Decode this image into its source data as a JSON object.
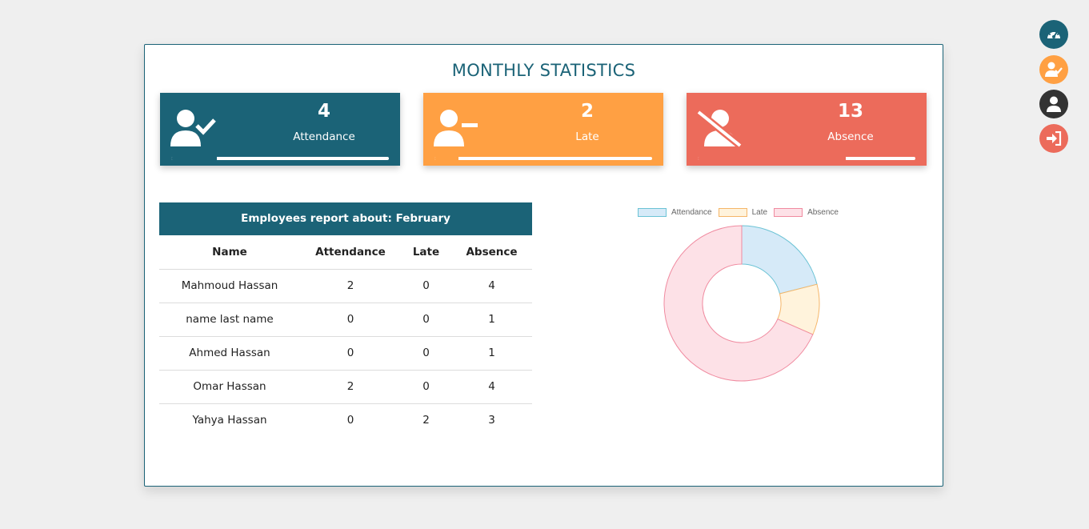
{
  "page": {
    "title": "MONTHLY STATISTICS"
  },
  "stats": [
    {
      "value": "4",
      "label": "Attendance",
      "icon": "user-check-icon",
      "color": "#1b6377",
      "progress": 0.21
    },
    {
      "value": "2",
      "label": "Late",
      "icon": "user-minus-icon",
      "color": "#ffa043",
      "progress": 0.11
    },
    {
      "value": "13",
      "label": "Absence",
      "icon": "user-slash-icon",
      "color": "#ec6b5b",
      "progress": 0.68
    }
  ],
  "report": {
    "header": "Employees report about: February",
    "columns": [
      "Name",
      "Attendance",
      "Late",
      "Absence"
    ],
    "rows": [
      [
        "Mahmoud Hassan",
        "2",
        "0",
        "4"
      ],
      [
        "name last name",
        "0",
        "0",
        "1"
      ],
      [
        "Ahmed Hassan",
        "0",
        "0",
        "1"
      ],
      [
        "Omar Hassan",
        "2",
        "0",
        "4"
      ],
      [
        "Yahya Hassan",
        "0",
        "2",
        "3"
      ]
    ]
  },
  "chart_data": {
    "type": "pie",
    "variant": "doughnut",
    "categories": [
      "Attendance",
      "Late",
      "Absence"
    ],
    "values": [
      4,
      2,
      13
    ],
    "legend": "top",
    "colors": [
      {
        "fill": "#d6eaf8",
        "stroke": "#6cc3d5"
      },
      {
        "fill": "#fff3dc",
        "stroke": "#f5b669"
      },
      {
        "fill": "#fde1e7",
        "stroke": "#f08ba0"
      }
    ]
  },
  "sidebar": {
    "buttons": [
      {
        "name": "dashboard-button",
        "icon": "gauge-icon",
        "color": "#1b6377"
      },
      {
        "name": "attendance-button",
        "icon": "user-check-icon",
        "color": "#ffa043"
      },
      {
        "name": "profile-button",
        "icon": "user-icon",
        "color": "#333333"
      },
      {
        "name": "logout-button",
        "icon": "sign-in-icon",
        "color": "#ec6b5b"
      }
    ]
  }
}
